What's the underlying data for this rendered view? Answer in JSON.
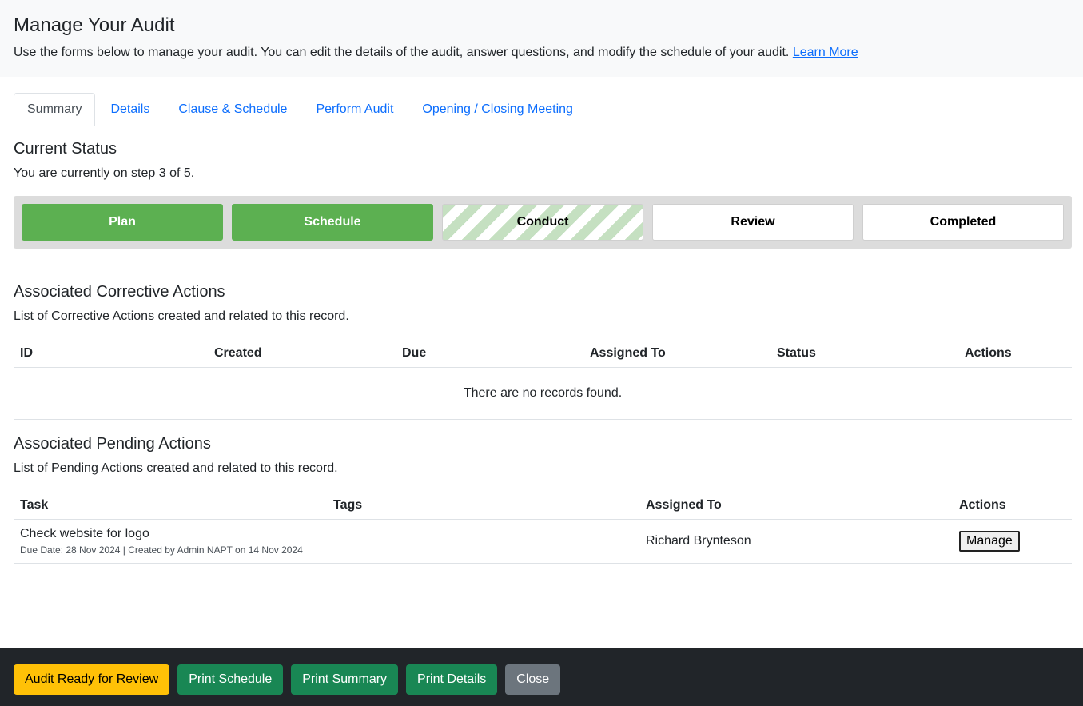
{
  "header": {
    "title": "Manage Your Audit",
    "subtitle": "Use the forms below to manage your audit. You can edit the details of the audit, answer questions, and modify the schedule of your audit.",
    "learn_more": "Learn More"
  },
  "tabs": [
    {
      "label": "Summary",
      "active": true
    },
    {
      "label": "Details"
    },
    {
      "label": "Clause & Schedule"
    },
    {
      "label": "Perform Audit"
    },
    {
      "label": "Opening / Closing Meeting"
    }
  ],
  "current_status": {
    "title": "Current Status",
    "text": "You are currently on step 3 of 5.",
    "steps": [
      {
        "label": "Plan",
        "state": "done"
      },
      {
        "label": "Schedule",
        "state": "done"
      },
      {
        "label": "Conduct",
        "state": "current"
      },
      {
        "label": "Review",
        "state": "pending"
      },
      {
        "label": "Completed",
        "state": "pending"
      }
    ],
    "colors": {
      "done": "#5cb051",
      "current_stripe": "#c5e0c1"
    }
  },
  "corrective_actions": {
    "title": "Associated Corrective Actions",
    "desc": "List of Corrective Actions created and related to this record.",
    "columns": [
      "ID",
      "Created",
      "Due",
      "Assigned To",
      "Status",
      "Actions"
    ],
    "empty": "There are no records found."
  },
  "pending_actions": {
    "title": "Associated Pending Actions",
    "desc": "List of Pending Actions created and related to this record.",
    "columns": [
      "Task",
      "Tags",
      "Assigned To",
      "Actions"
    ],
    "rows": [
      {
        "task": "Check website for logo",
        "meta": "Due Date: 28 Nov 2024 | Created by Admin NAPT on 14 Nov 2024",
        "tags": "",
        "assigned_to": "Richard Brynteson",
        "action": "Manage"
      }
    ]
  },
  "footer": {
    "buttons": [
      {
        "label": "Audit Ready for Review",
        "style": "warning",
        "color": "#ffc107"
      },
      {
        "label": "Print Schedule",
        "style": "success",
        "color": "#198754"
      },
      {
        "label": "Print Summary",
        "style": "success",
        "color": "#198754"
      },
      {
        "label": "Print Details",
        "style": "success",
        "color": "#198754"
      },
      {
        "label": "Close",
        "style": "secondary",
        "color": "#6c757d"
      }
    ]
  }
}
